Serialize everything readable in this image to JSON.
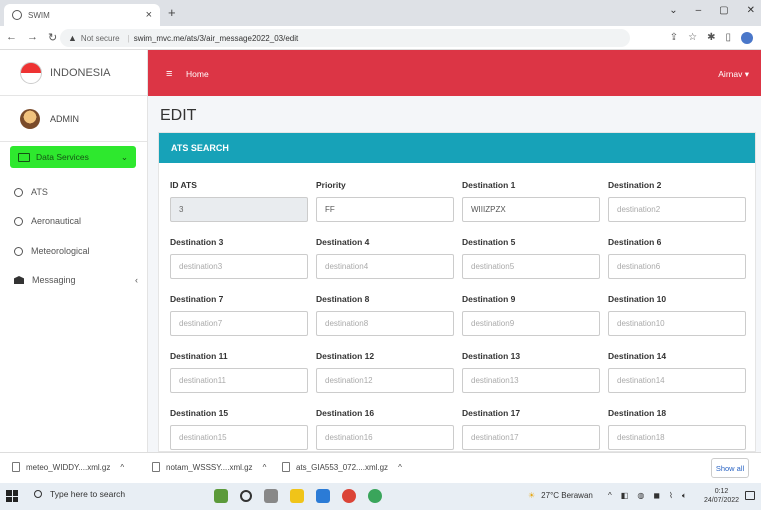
{
  "browser": {
    "tab_title": "SWIM",
    "address_not_secure": "Not secure",
    "url": "swim_mvc.me/ats/3/air_message2022_03/edit"
  },
  "sidebar": {
    "brand": "INDONESIA",
    "user": "ADMIN",
    "data_services": "Data Services",
    "items": [
      {
        "label": "ATS",
        "icon": "circle-icon"
      },
      {
        "label": "Aeronautical",
        "icon": "circle-icon"
      },
      {
        "label": "Meteorological",
        "icon": "circle-icon"
      },
      {
        "label": "Messaging",
        "icon": "envelope-icon"
      }
    ]
  },
  "header": {
    "home": "Home",
    "user_menu": "Airnav ▾"
  },
  "page_title": "EDIT",
  "card_title": "ATS SEARCH",
  "fields": [
    {
      "label": "ID ATS",
      "value": "3",
      "placeholder": ""
    },
    {
      "label": "Priority",
      "value": "FF",
      "placeholder": ""
    },
    {
      "label": "Destination 1",
      "value": "WIIIZPZX",
      "placeholder": ""
    },
    {
      "label": "Destination 2",
      "value": "",
      "placeholder": "destination2"
    },
    {
      "label": "Destination 3",
      "value": "",
      "placeholder": "destination3"
    },
    {
      "label": "Destination 4",
      "value": "",
      "placeholder": "destination4"
    },
    {
      "label": "Destination 5",
      "value": "",
      "placeholder": "destination5"
    },
    {
      "label": "Destination 6",
      "value": "",
      "placeholder": "destination6"
    },
    {
      "label": "Destination 7",
      "value": "",
      "placeholder": "destination7"
    },
    {
      "label": "Destination 8",
      "value": "",
      "placeholder": "destination8"
    },
    {
      "label": "Destination 9",
      "value": "",
      "placeholder": "destination9"
    },
    {
      "label": "Destination 10",
      "value": "",
      "placeholder": "destination10"
    },
    {
      "label": "Destination 11",
      "value": "",
      "placeholder": "destination11"
    },
    {
      "label": "Destination 12",
      "value": "",
      "placeholder": "destination12"
    },
    {
      "label": "Destination 13",
      "value": "",
      "placeholder": "destination13"
    },
    {
      "label": "Destination 14",
      "value": "",
      "placeholder": "destination14"
    },
    {
      "label": "Destination 15",
      "value": "",
      "placeholder": "destination15"
    },
    {
      "label": "Destination 16",
      "value": "",
      "placeholder": "destination16"
    },
    {
      "label": "Destination 17",
      "value": "",
      "placeholder": "destination17"
    },
    {
      "label": "Destination 18",
      "value": "",
      "placeholder": "destination18"
    }
  ],
  "downloads": {
    "items": [
      "meteo_WIDDY....xml.gz",
      "notam_WSSSY....xml.gz",
      "ats_GIA553_072....xml.gz"
    ],
    "show_all": "Show all"
  },
  "taskbar": {
    "search": "Type here to search",
    "weather": "27°C Berawan",
    "time": "0:12",
    "date": "24/07/2022"
  },
  "colors": {
    "header": "#dc3545",
    "card_header": "#17a2b8",
    "active_menu": "#2ee82e"
  }
}
